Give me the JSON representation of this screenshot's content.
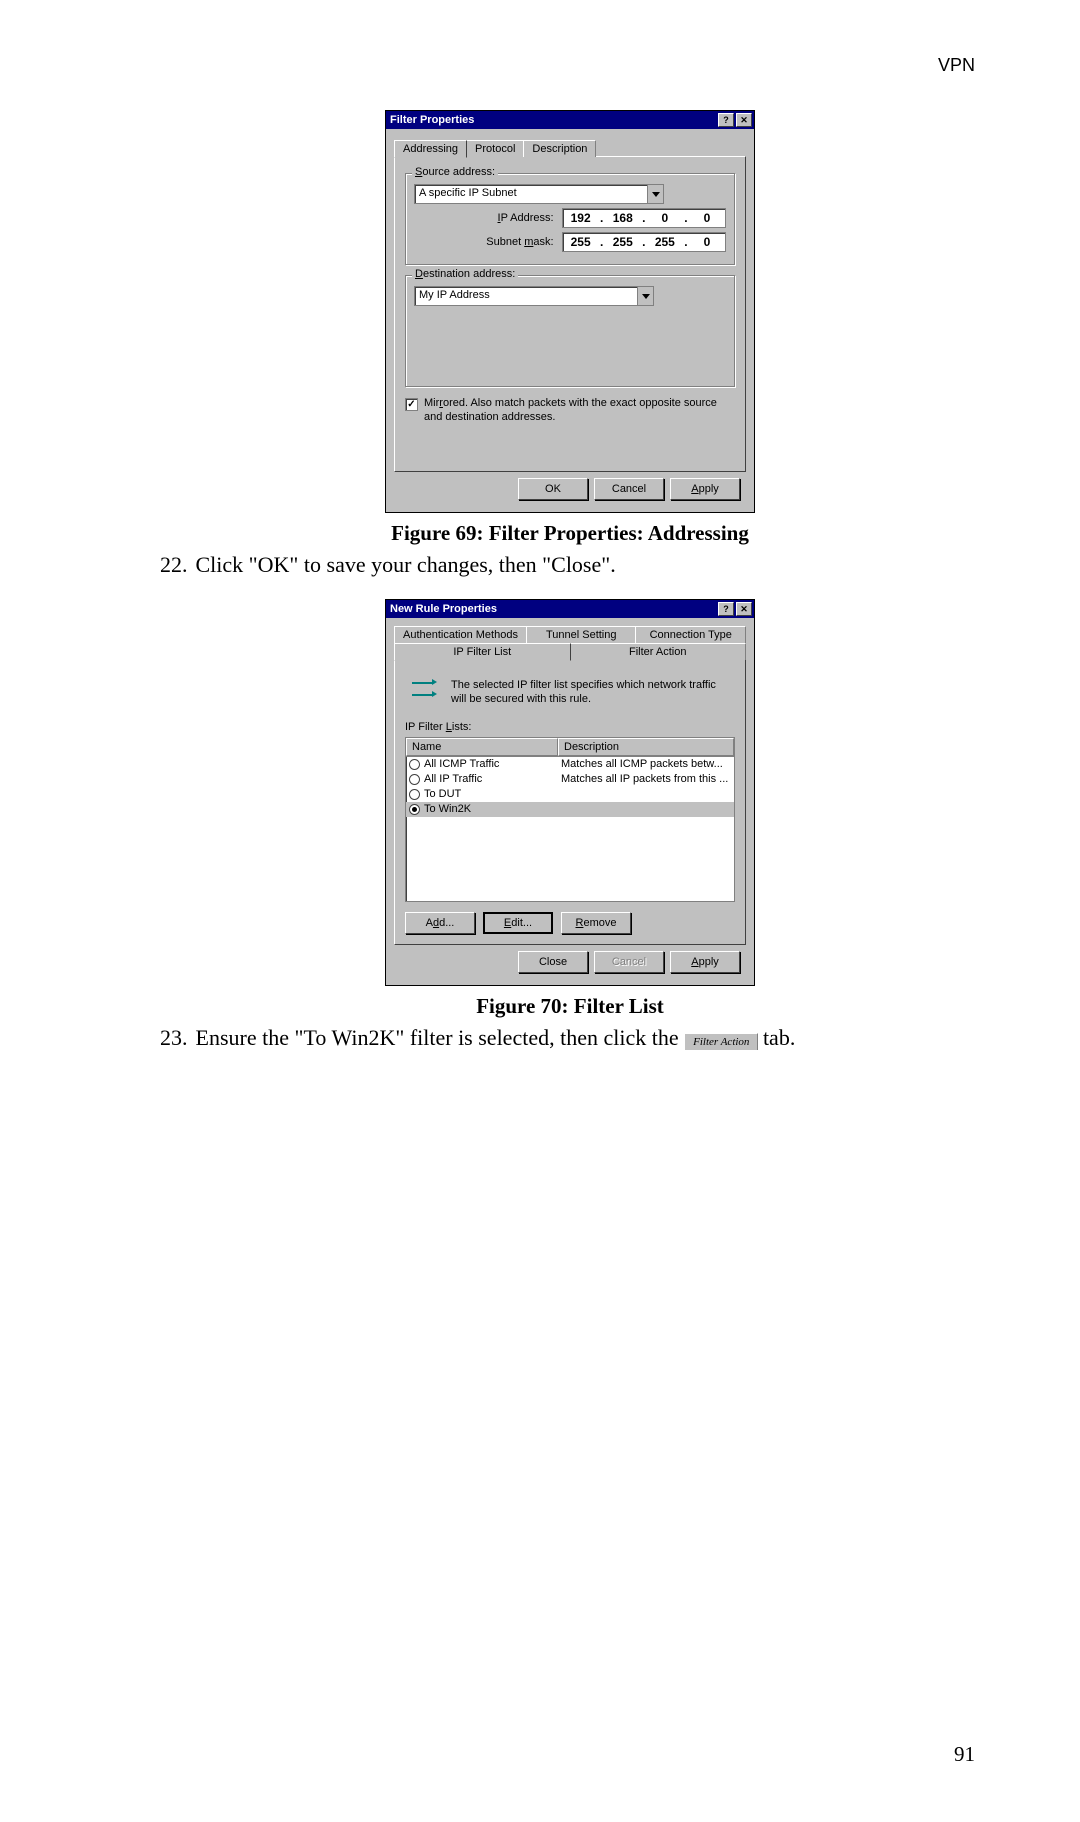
{
  "header": {
    "section": "VPN"
  },
  "page_number": "91",
  "dialog1": {
    "title": "Filter Properties",
    "tabs": [
      "Addressing",
      "Protocol",
      "Description"
    ],
    "source_legend": "Source address:",
    "source_type": "A specific IP Subnet",
    "ip_label": "IP Address:",
    "ip": [
      "192",
      "168",
      "0",
      "0"
    ],
    "mask_label": "Subnet mask:",
    "mask": [
      "255",
      "255",
      "255",
      "0"
    ],
    "dest_legend": "Destination address:",
    "dest_type": "My IP Address",
    "mirrored_label": "Mirrored. Also match packets with the exact opposite source and destination addresses.",
    "ok": "OK",
    "cancel": "Cancel",
    "apply": "Apply"
  },
  "caption1": "Figure 69: Filter Properties: Addressing",
  "step22_num": "22.",
  "step22_text": "Click \"OK\" to save your changes, then \"Close\".",
  "dialog2": {
    "title": "New Rule Properties",
    "tabs_top": [
      "Authentication Methods",
      "Tunnel Setting",
      "Connection Type"
    ],
    "tabs_bot": [
      "IP Filter List",
      "Filter Action"
    ],
    "intro": "The selected IP filter list specifies which network traffic will be secured with this rule.",
    "list_label": "IP Filter Lists:",
    "col_name": "Name",
    "col_desc": "Description",
    "rows": [
      {
        "name": "All ICMP Traffic",
        "desc": "Matches all ICMP packets betw...",
        "selected": false
      },
      {
        "name": "All IP Traffic",
        "desc": "Matches all IP packets from this ...",
        "selected": false
      },
      {
        "name": "To DUT",
        "desc": "",
        "selected": false
      },
      {
        "name": "To Win2K",
        "desc": "",
        "selected": true
      }
    ],
    "add": "Add...",
    "edit": "Edit...",
    "remove": "Remove",
    "close": "Close",
    "cancel": "Cancel",
    "apply": "Apply"
  },
  "caption2": "Figure 70: Filter List",
  "step23_num": "23.",
  "step23_text_a": "Ensure the \"To Win2K\" filter is selected, then click the ",
  "step23_text_b": "Filter Action",
  "step23_text_c": " tab."
}
